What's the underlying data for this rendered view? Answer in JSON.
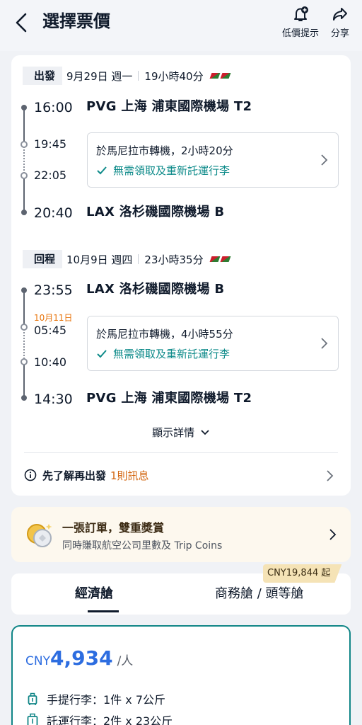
{
  "header": {
    "title": "選擇票價",
    "alert_label": "低價提示",
    "share_label": "分享"
  },
  "outbound": {
    "tag": "出發",
    "date": "9月29日 週一",
    "duration": "19小時40分",
    "dep_time": "16:00",
    "dep_airport": "PVG 上海 浦東國際機場 T2",
    "transfer_arr_time": "19:45",
    "transfer_dep_time": "22:05",
    "transfer_text": "於馬尼拉市轉機，2小時20分",
    "baggage_note": "無需領取及重新託運行李",
    "arr_time": "20:40",
    "arr_airport": "LAX 洛杉磯國際機場 B"
  },
  "inbound": {
    "tag": "回程",
    "date": "10月9日 週四",
    "duration": "23小時35分",
    "dep_time": "23:55",
    "dep_airport": "LAX 洛杉磯國際機場 B",
    "next_day_date": "10月11日",
    "transfer_arr_time": "05:45",
    "transfer_dep_time": "10:40",
    "transfer_text": "於馬尼拉市轉機，4小時55分",
    "baggage_note": "無需領取及重新託運行李",
    "arr_time": "14:30",
    "arr_airport": "PVG 上海 浦東國際機場 T2"
  },
  "details_toggle": "顯示詳情",
  "notice": {
    "lead": "先了解再出發",
    "count": "1則訊息"
  },
  "promo": {
    "title": "一張訂單，雙重獎賞",
    "subtitle": "同時賺取航空公司里數及 Trip Coins"
  },
  "cabin_tabs": {
    "economy": "經濟艙",
    "business": "商務艙 / 頭等艙",
    "business_price_tag": "CNY19,844 起"
  },
  "fare": {
    "currency": "CNY",
    "amount": "4,934",
    "per": "/人",
    "carry_on": "手提行李：1件 x 7公斤",
    "checked": "託運行李：2件 x 23公斤"
  },
  "colors": {
    "accent_teal": "#118687",
    "price_blue": "#2d6de0",
    "warning_orange": "#e8740c"
  },
  "icons": [
    "chevron-left-icon",
    "bell-plus-icon",
    "share-icon",
    "check-icon",
    "chevron-right-icon",
    "info-icon",
    "chevron-down-icon",
    "coin-icon",
    "carry-on-bag-icon",
    "checked-bag-icon"
  ]
}
